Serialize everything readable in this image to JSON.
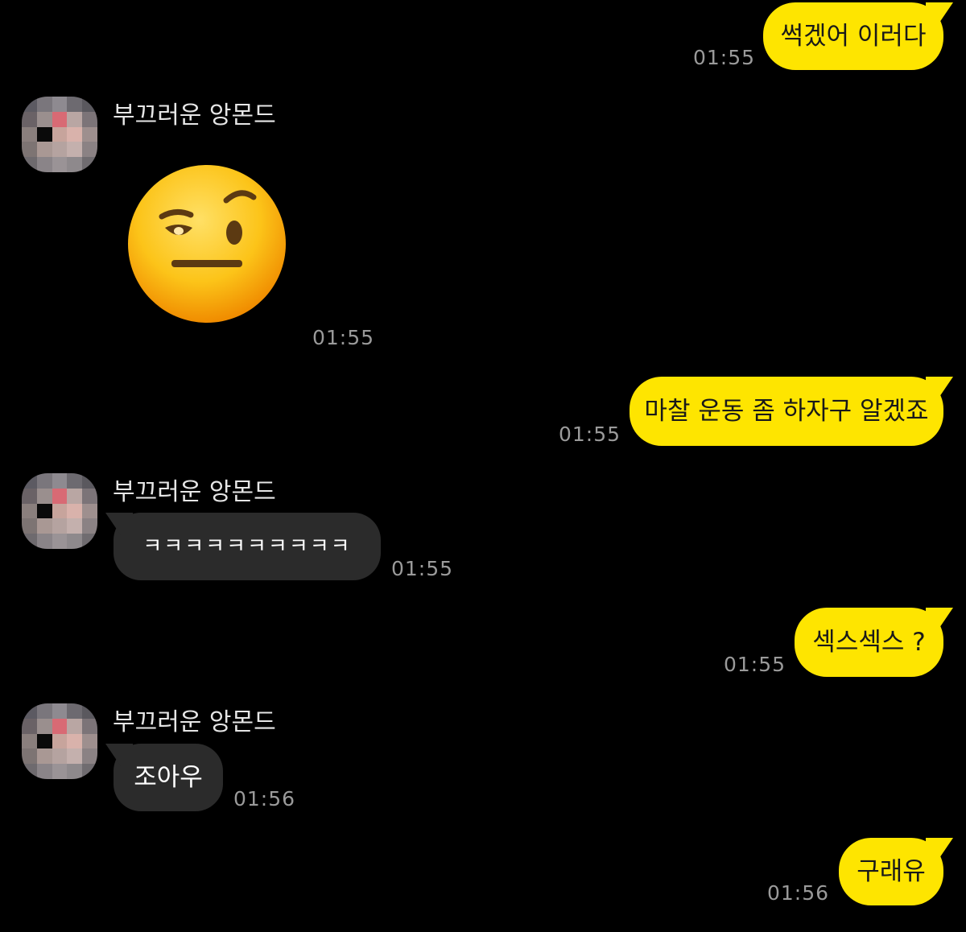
{
  "chat": {
    "sender_name": "부끄러운 앙몬드",
    "messages": [
      {
        "direction": "out",
        "text": "썩겠어 이러다",
        "time": "01:55"
      },
      {
        "direction": "in",
        "type": "emoji",
        "emoji": "face-with-raised-eyebrow-icon",
        "time": "01:55"
      },
      {
        "direction": "out",
        "text": "마찰 운동 좀 하자구 알겠죠",
        "time": "01:55"
      },
      {
        "direction": "in",
        "text": "ㅋㅋㅋㅋㅋㅋㅋㅋㅋㅋ",
        "time": "01:55"
      },
      {
        "direction": "out",
        "text": "섹스섹스 ?",
        "time": "01:55"
      },
      {
        "direction": "in",
        "text": "조아우",
        "time": "01:56"
      },
      {
        "direction": "out",
        "text": "구래유",
        "time": "01:56"
      }
    ]
  },
  "colors": {
    "background": "#000000",
    "outgoing_bubble": "#FEE500",
    "incoming_bubble": "#2B2B2B",
    "timestamp": "#9A9A9A"
  }
}
